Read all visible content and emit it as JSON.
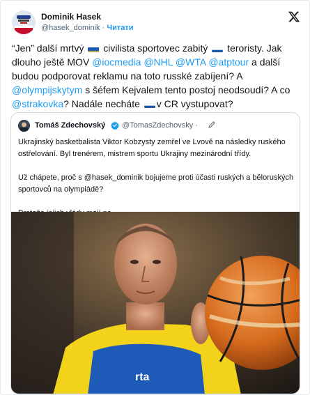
{
  "author": {
    "name": "Dominik Hasek",
    "handle": "@hasek_dominik",
    "separator": "·",
    "follow_label": "Читати"
  },
  "tweet": {
    "t1": "“Jen” další mrtvý",
    "t2": "civilista sportovec zabitý",
    "t3": "teroristy. Jak dlouho ještě MOV",
    "m1": "@iocmedia",
    "m2": "@NHL",
    "m3": "@WTA",
    "m4": "@atptour",
    "t4": "a další budou podporovat reklamu na toto russké zabíjení? A",
    "m5": "@olympijskytym",
    "t5": "s šéfem Kejvalem tento postoj neodsoudí? A co",
    "m6": "@strakovka",
    "t6": "? Nadále necháte",
    "t7": "v CR vystupovat?"
  },
  "quote": {
    "name": "Tomáš Zdechovský",
    "handle": "@TomasZdechovsky",
    "separator": "·",
    "p1": "Ukrajinský basketbalista Viktor Kobzysty zemřel ve Lvově na následky ruského ostřelování. Byl trenérem, mistrem sportu Ukrajiny mezinárodní třídy.",
    "p2": "Už chápete, proč s @hasek_dominik bojujeme proti účasti ruských a běloruských sportovců na olympiádě?",
    "p3": "Protože jejich vlády mají na..."
  },
  "photo": {
    "jersey_text": "rta"
  },
  "colors": {
    "link": "#1d9bf0",
    "secondary_text": "#536471",
    "border": "#cfd9de",
    "ukraine_blue": "#1e5bb8",
    "ukraine_yellow": "#f2d21b"
  },
  "icons": [
    "x-logo-icon",
    "verified-badge-icon",
    "edit-pencil-icon",
    "ukraine-flag-icon",
    "russia-flag-icon"
  ]
}
